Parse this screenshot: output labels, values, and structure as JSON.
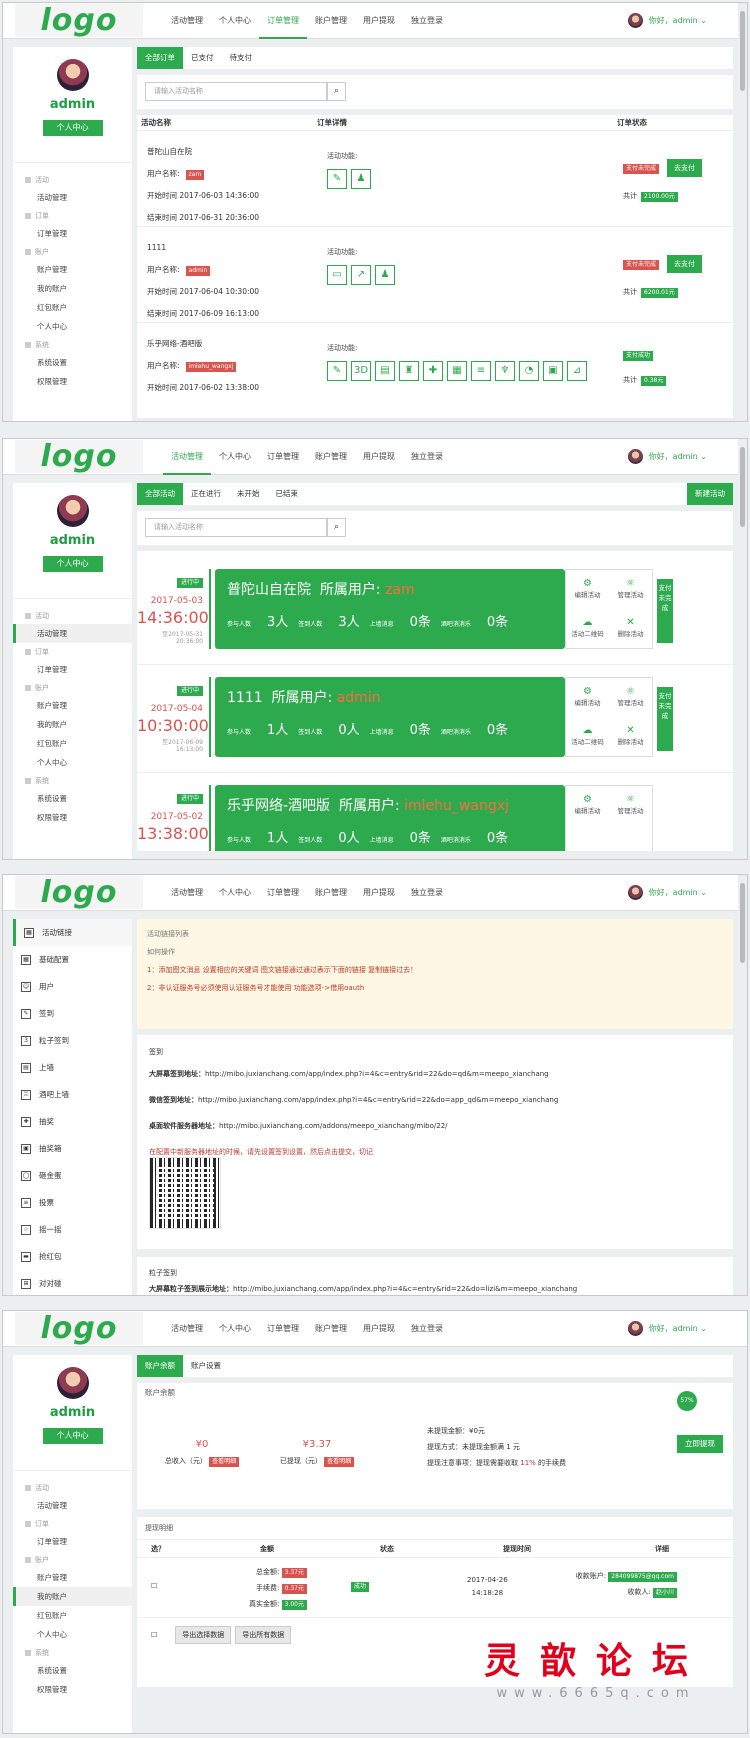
{
  "common": {
    "logo": "logo",
    "nav": [
      "活动管理",
      "个人中心",
      "订单管理",
      "账户管理",
      "用户提现",
      "独立登录"
    ],
    "greeting": "你好，admin",
    "admin_name": "admin",
    "user_center": "个人中心",
    "menu": [
      {
        "group": "活动",
        "items": [
          "活动管理"
        ]
      },
      {
        "group": "订单",
        "items": [
          "订单管理"
        ]
      },
      {
        "group": "账户",
        "items": [
          "账户管理",
          "我的账户",
          "红包账户",
          "个人中心"
        ]
      },
      {
        "group": "系统",
        "items": [
          "系统设置",
          "权限管理"
        ]
      }
    ],
    "search_placeholder": "请输入活动名称"
  },
  "orders": {
    "tabs": [
      "全部订单",
      "已支付",
      "待支付"
    ],
    "headers": [
      "活动名称",
      "订单详情",
      "订单状态"
    ],
    "label_user": "用户名称:",
    "label_start": "开始时间",
    "label_end": "结束时间",
    "label_func": "活动功能:",
    "label_total": "共计",
    "rows": [
      {
        "name": "普陀山自在院",
        "user": "zam",
        "start": "2017-06-03 14:36:00",
        "end": "2017-06-31 20:36:00",
        "status": "支付未完成",
        "action": "去支付",
        "amount": "2100.00元"
      },
      {
        "name": "1111",
        "user": "admin",
        "start": "2017-06-04 10:30:00",
        "end": "2017-06-09 16:13:00",
        "status": "支付未完成",
        "action": "去支付",
        "amount": "6200.01元"
      },
      {
        "name": "乐乎网络-酒吧版",
        "user": "imlehu_wangxj",
        "start": "2017-06-02 13:38:00",
        "end": "",
        "status": "支付成功",
        "action": "",
        "amount": "0.38元"
      }
    ]
  },
  "activities": {
    "tabs": [
      "全部活动",
      "正在进行",
      "未开始",
      "已结束"
    ],
    "new_button": "新建活动",
    "owner_label": "所属用户:",
    "stat_labels": [
      "参与人数",
      "签到人数",
      "上墙消息",
      "酒吧消消乐"
    ],
    "ops": [
      "编辑活动",
      "管理活动",
      "活动二维码",
      "删除活动"
    ],
    "pay_tag": "支付未完成",
    "items": [
      {
        "status": "进行中",
        "date": "2017-05-03",
        "time": "14:36:00",
        "until": "至2017-05-31 20:36:00",
        "title": "普陀山自在院",
        "owner": "zam",
        "participants": "3人",
        "signed": "3人",
        "wall": "0条",
        "game": "0条"
      },
      {
        "status": "进行中",
        "date": "2017-05-04",
        "time": "10:30:00",
        "until": "至2017-06-09 16:13:00",
        "title": "1111",
        "owner": "admin",
        "participants": "1人",
        "signed": "0人",
        "wall": "0条",
        "game": "0条"
      },
      {
        "status": "进行中",
        "date": "2017-05-02",
        "time": "13:38:00",
        "until": "",
        "title": "乐乎网络-酒吧版",
        "owner": "imlehu_wangxj",
        "participants": "1人",
        "signed": "0人",
        "wall": "0条",
        "game": "0条"
      }
    ]
  },
  "links": {
    "side": [
      "活动链接",
      "基础配置",
      "用户",
      "签到",
      "粒子签到",
      "上墙",
      "酒吧上墙",
      "抽奖",
      "抽奖箱",
      "砸金蛋",
      "投票",
      "摇一摇",
      "抢红包",
      "对对碰"
    ],
    "notice_title": "活动链接列表",
    "how": "如何操作",
    "step1": "1：添加图文消息 设置相应的关键词 图文链接通过通过表示下面的链接 复制链接过去！",
    "step2": "2：非认证服务号必须使用认证服务号才能使用 功能选项->借用oauth",
    "section1": "签到",
    "big_label": "大屏幕签到地址：",
    "big_url": "http://mibo.juxianchang.com/app/index.php?i=4&c=entry&rid=22&do=qd&m=meepo_xianchang",
    "wx_label": "微信签到地址：",
    "wx_url": "http://mibo.juxianchang.com/app/index.php?i=4&c=entry&rid=22&do=app_qd&m=meepo_xianchang",
    "desk_label": "桌面软件服务器地址：",
    "desk_url": "http://mibo.juxianchang.com/addons/meepo_xianchang/mibo/22/",
    "warn": "在配置中新服务器地址的时候，请先设置签到设置，然后点击提交，切记",
    "section2": "粒子签到",
    "p_label": "大屏幕粒子签到展示地址：",
    "p_url": "http://mibo.juxianchang.com/app/index.php?i=4&c=entry&rid=22&do=lizi&m=meepo_xianchang"
  },
  "finance": {
    "tabs": [
      "账户余额",
      "账户设置"
    ],
    "balance_title": "账户余额",
    "total_income": "¥0",
    "total_income_label": "总收入（元）",
    "withdrawn": "¥3.37",
    "withdrawn_label": "已提现（元）",
    "detail_tag": "查看明细",
    "unwithdrawn": "未提现金额：¥0元",
    "method": "提现方式：未提现金额满 1 元",
    "note_pre": "提现注意事项：提现需要收取 ",
    "note_pct": "11%",
    "note_post": " 的手续费",
    "withdraw_btn": "立即提现",
    "percent": "57%",
    "detail_title": "提现明细",
    "cols": [
      "选？",
      "金额",
      "状态",
      "提现时间",
      "详细"
    ],
    "row": {
      "total_label": "总金额",
      "total": "3.37元",
      "fee_label": "手续费",
      "fee": "0.37元",
      "real_label": "真实金额",
      "real": "3.00元",
      "status": "成功",
      "date": "2017-04-26",
      "time": "14:18:28",
      "acct_label": "收款账户",
      "acct": "284099875@qq.com",
      "person_label": "收款人",
      "person": "赵小川"
    },
    "btn_sel": "导出选择数据",
    "btn_all": "导出所有数据"
  },
  "watermark": {
    "cn": "灵歆论坛",
    "url": "www.6665q.com"
  }
}
